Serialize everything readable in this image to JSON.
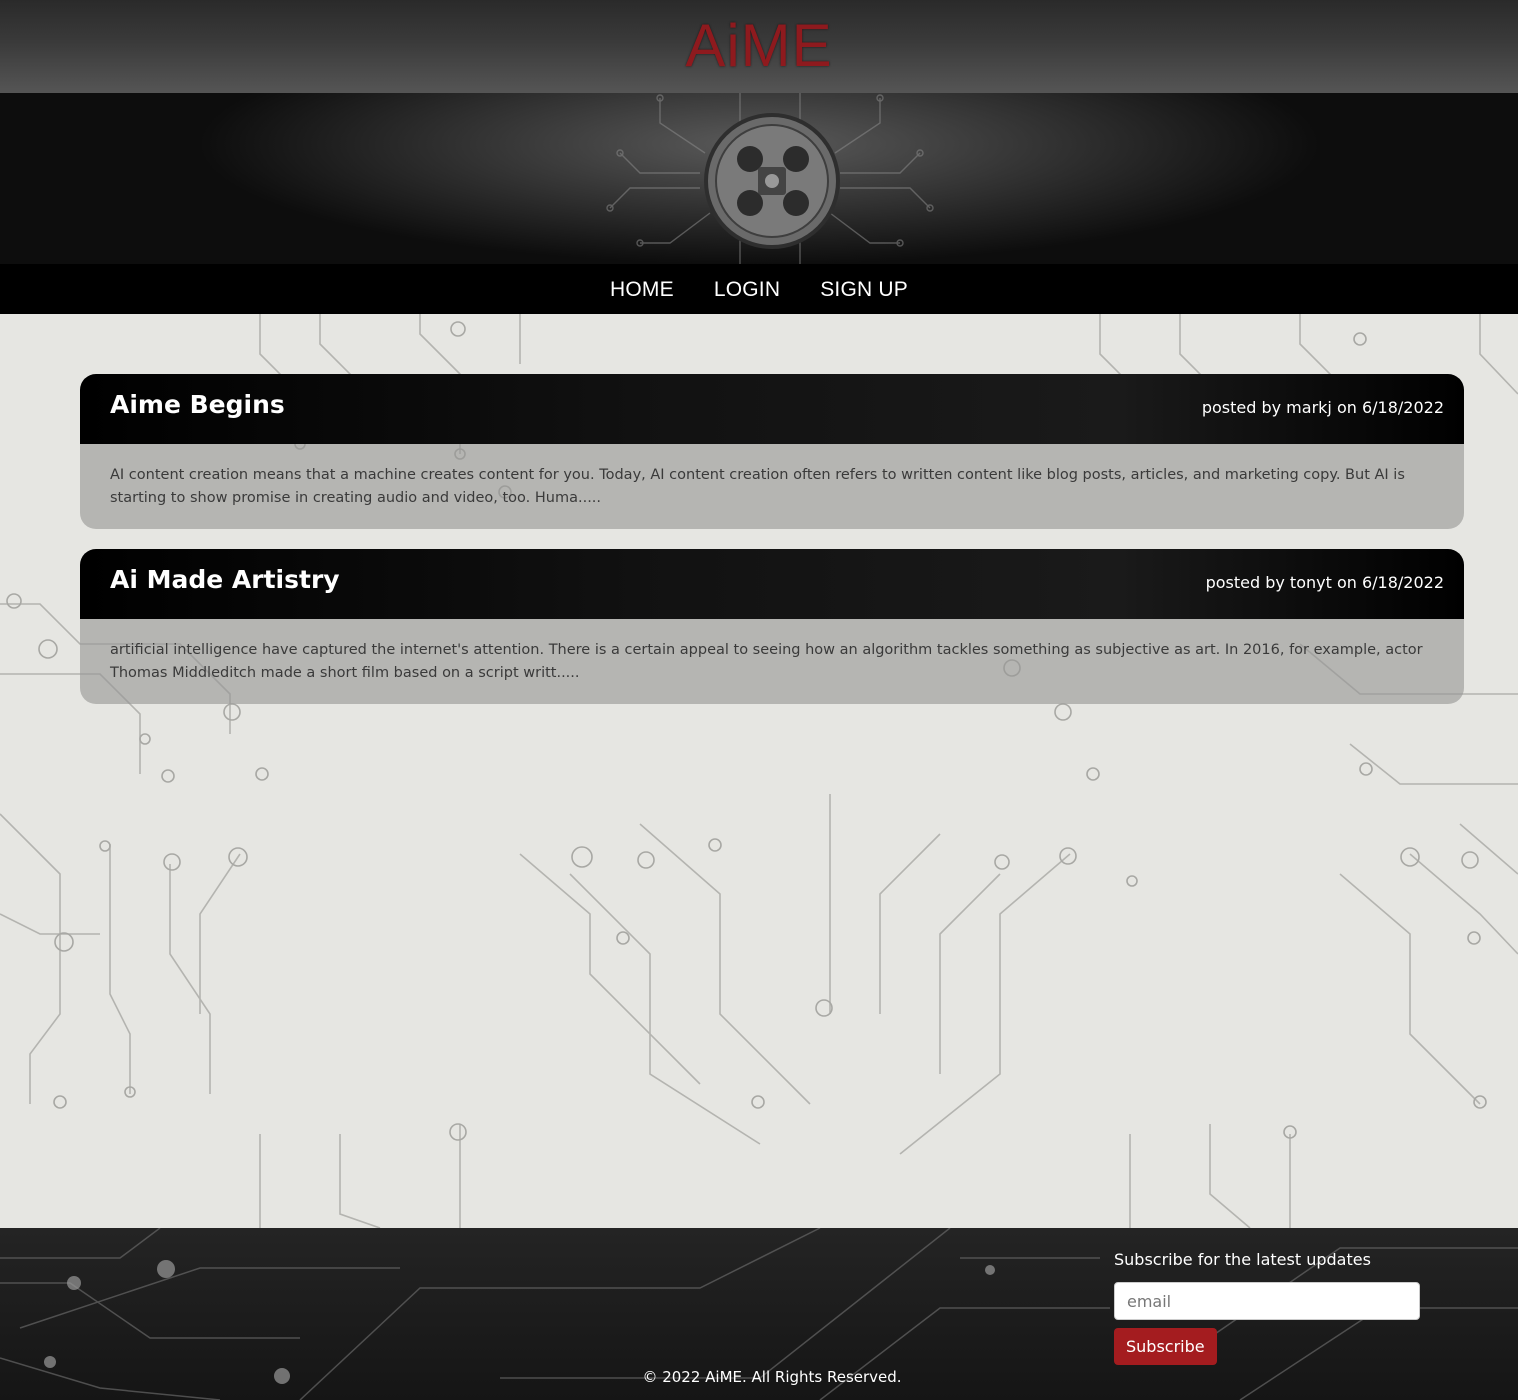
{
  "header": {
    "logo": "AiME"
  },
  "nav": {
    "items": [
      "HOME",
      "LOGIN",
      "SIGN UP"
    ]
  },
  "posts": [
    {
      "title": "Aime Begins",
      "meta": "posted by markj on 6/18/2022",
      "excerpt": "AI content creation means that a machine creates content for you. Today, AI content creation often refers to written content like blog posts, articles, and marketing copy. But AI is starting to show promise in creating audio and video, too. Huma....."
    },
    {
      "title": "Ai Made Artistry",
      "meta": "posted by tonyt on 6/18/2022",
      "excerpt": "artificial intelligence have captured the internet's attention. There is a certain appeal to seeing how an algorithm tackles something as subjective as art. In 2016, for example, actor Thomas Middleditch made a short film based on a script writt....."
    }
  ],
  "footer": {
    "subscribe_label": "Subscribe for the latest updates",
    "email_placeholder": "email",
    "subscribe_button": "Subscribe",
    "copyright": "© 2022 AiME. All Rights Reserved."
  },
  "colors": {
    "brand": "#8e1a1e",
    "button": "#a41c1f",
    "nav_bg": "#000000"
  }
}
